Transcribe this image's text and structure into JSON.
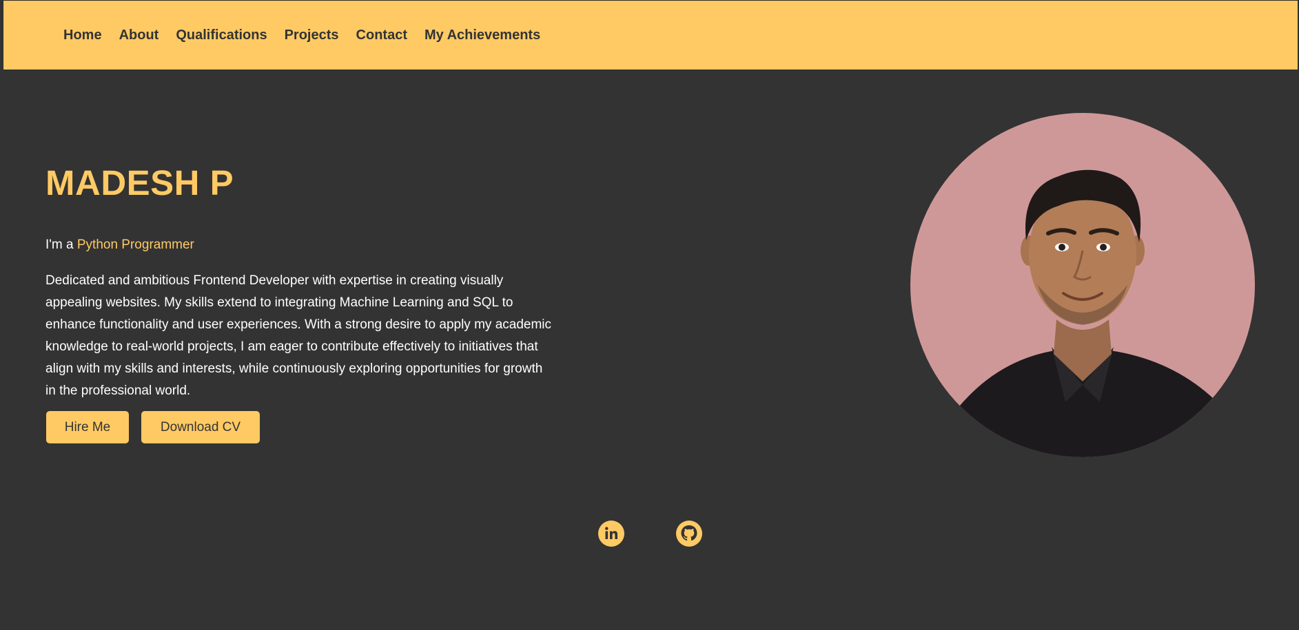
{
  "nav": {
    "items": [
      {
        "label": "Home"
      },
      {
        "label": "About"
      },
      {
        "label": "Qualifications"
      },
      {
        "label": "Projects"
      },
      {
        "label": "Contact"
      },
      {
        "label": "My Achievements"
      }
    ]
  },
  "hero": {
    "name": "MADESH P",
    "tagline_prefix": "I'm a",
    "tagline_role": "Python Programmer",
    "bio": "Dedicated and ambitious Frontend Developer with expertise in creating visually appealing websites. My skills extend to integrating Machine Learning and SQL to enhance functionality and user experiences. With a strong desire to apply my academic knowledge to real-world projects, I am eager to contribute effectively to initiatives that align with my skills and interests, while continuously exploring opportunities for growth in the professional world.",
    "buttons": {
      "hire": "Hire Me",
      "cv": "Download CV"
    }
  },
  "social": {
    "icons": [
      "linkedin-icon",
      "github-icon"
    ]
  },
  "colors": {
    "accent": "#ffca64",
    "background": "#333333",
    "text": "#ffffff",
    "avatar_bg": "#cf9898"
  }
}
